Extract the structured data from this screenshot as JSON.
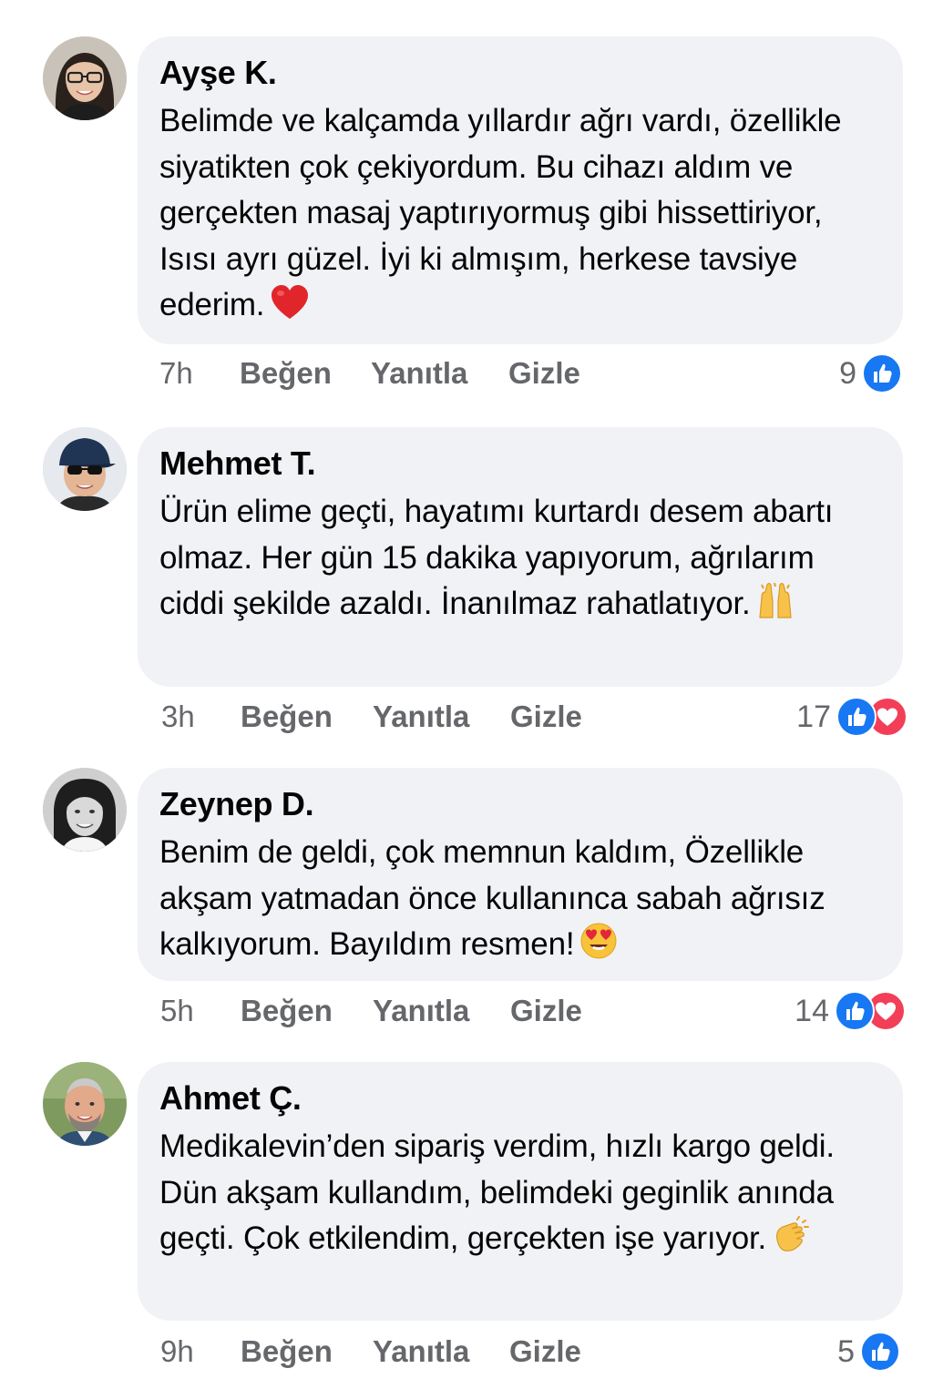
{
  "comments": [
    {
      "author": "Ayşe K.",
      "text": "Belimde ve kalçamda yıllardır ağrı vardı, özellikle siyatikten çok çekiyordum. Bu cihazı aldım ve gerçekten masaj yaptırıyormuş gibi hissettiriyor, Isısı ayrı güzel. İyi ki almışım, herkese tavsiye ederim.",
      "emoji": "❤️",
      "emoji_icon": "red-heart-icon",
      "time": "7h",
      "like_label": "Beğen",
      "reply_label": "Yanıtla",
      "hide_label": "Gizle",
      "reaction_count": "9",
      "reactions": [
        "like"
      ]
    },
    {
      "author": "Mehmet T.",
      "text": "Ürün elime geçti, hayatımı kurtardı desem abartı olmaz. Her gün 15 dakika yapıyorum, ağrılarım ciddi şekilde azaldı. İnanılmaz rahatlatıyor.",
      "emoji": "🙌",
      "emoji_icon": "raising-hands-icon",
      "time": "3h",
      "like_label": "Beğen",
      "reply_label": "Yanıtla",
      "hide_label": "Gizle",
      "reaction_count": "17",
      "reactions": [
        "like",
        "love"
      ]
    },
    {
      "author": "Zeynep D.",
      "text": "Benim de geldi, çok memnun kaldım, Özellikle akşam yatmadan önce kullanınca sabah ağrısız kalkıyorum. Bayıldım resmen!",
      "emoji": "😍",
      "emoji_icon": "heart-eyes-icon",
      "time": "5h",
      "like_label": "Beğen",
      "reply_label": "Yanıtla",
      "hide_label": "Gizle",
      "reaction_count": "14",
      "reactions": [
        "like",
        "love"
      ]
    },
    {
      "author": "Ahmet Ç.",
      "text": "Medikalevin’den sipariş verdim, hızlı kargo geldi. Dün akşam kullandım, belimdeki geginlik anında geçti. Çok etkilendim, gerçekten işe yarıyor.",
      "emoji": "👏",
      "emoji_icon": "clapping-hands-icon",
      "time": "9h",
      "like_label": "Beğen",
      "reply_label": "Yanıtla",
      "hide_label": "Gizle",
      "reaction_count": "5",
      "reactions": [
        "like"
      ]
    }
  ],
  "colors": {
    "bubble_bg": "#f0f2f5",
    "meta_text": "#65676b",
    "like_blue": "#1877f2",
    "love_red": "#f33e58"
  }
}
